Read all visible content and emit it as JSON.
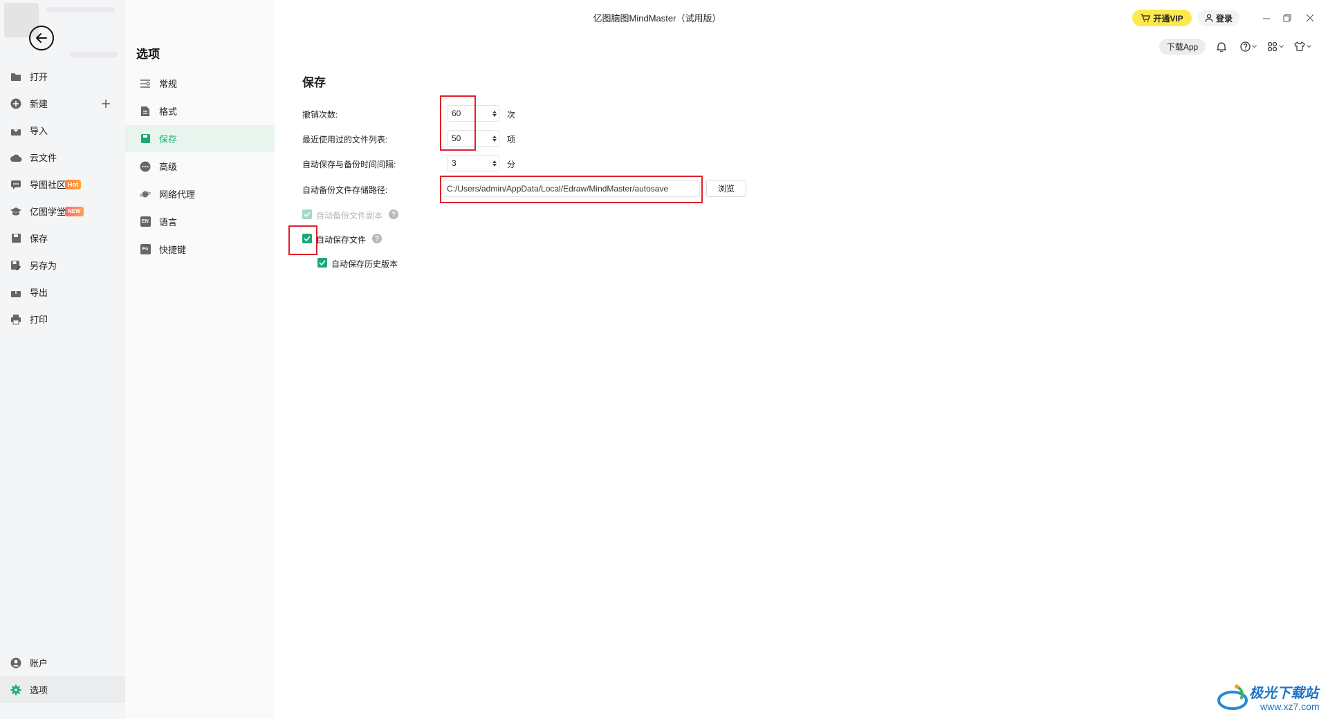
{
  "window": {
    "title": "亿图脑图MindMaster（试用版）",
    "vip_label": "开通VIP",
    "login_label": "登录",
    "download_app_label": "下载App"
  },
  "sidebar": {
    "items": [
      {
        "label": "打开",
        "icon": "folder-icon"
      },
      {
        "label": "新建",
        "icon": "plus-circle-icon"
      },
      {
        "label": "导入",
        "icon": "import-icon"
      },
      {
        "label": "云文件",
        "icon": "cloud-icon"
      },
      {
        "label": "导图社区",
        "icon": "community-icon",
        "badge": "Hot"
      },
      {
        "label": "亿图学堂",
        "icon": "graduation-cap-icon",
        "badge": "NEW"
      },
      {
        "label": "保存",
        "icon": "save-icon"
      },
      {
        "label": "另存为",
        "icon": "save-as-icon"
      },
      {
        "label": "导出",
        "icon": "export-icon"
      },
      {
        "label": "打印",
        "icon": "printer-icon"
      }
    ],
    "bottom": [
      {
        "label": "账户",
        "icon": "user-icon"
      },
      {
        "label": "选项",
        "icon": "gear-icon",
        "active": true
      }
    ]
  },
  "options": {
    "title": "选项",
    "items": [
      {
        "label": "常规",
        "icon": "general-icon"
      },
      {
        "label": "格式",
        "icon": "format-icon"
      },
      {
        "label": "保存",
        "icon": "save-icon",
        "active": true
      },
      {
        "label": "高级",
        "icon": "more-icon"
      },
      {
        "label": "网络代理",
        "icon": "planet-icon"
      },
      {
        "label": "语言",
        "icon": "language-icon",
        "glyph": "EN"
      },
      {
        "label": "快捷键",
        "icon": "shortcut-icon",
        "glyph": "Fn"
      }
    ]
  },
  "save": {
    "section_title": "保存",
    "undo_label": "撤销次数:",
    "undo_value": "60",
    "undo_unit": "次",
    "recent_label": "最近使用过的文件列表:",
    "recent_value": "50",
    "recent_unit": "项",
    "interval_label": "自动保存与备份时间间隔:",
    "interval_value": "3",
    "interval_unit": "分",
    "path_label": "自动备份文件存储路径:",
    "path_value": "C:/Users/admin/AppData/Local/Edraw/MindMaster/autosave",
    "browse_label": "浏览",
    "backup_copy_label": "自动备份文件副本",
    "backup_copy_checked": true,
    "backup_copy_disabled": true,
    "autosave_label": "自动保存文件",
    "autosave_checked": true,
    "history_label": "自动保存历史版本",
    "history_checked": true
  },
  "watermark": {
    "text": "极光下载站",
    "url": "www.xz7.com"
  },
  "colors": {
    "accent": "#19a974",
    "vip": "#fde94c",
    "highlight_box": "#e0202a"
  }
}
